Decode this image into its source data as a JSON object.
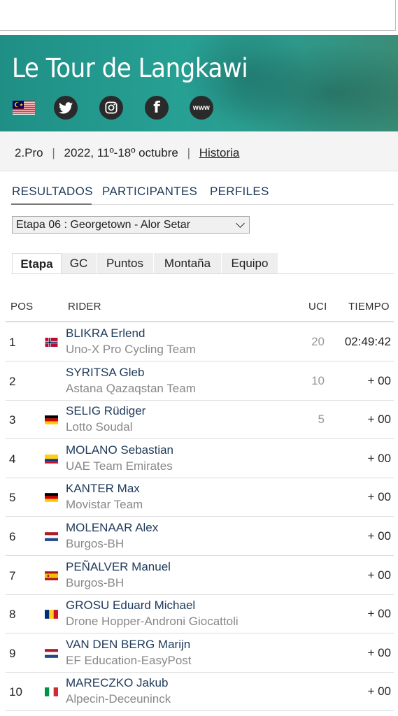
{
  "banner": {
    "title": "Le Tour de Langkawi",
    "social": {
      "twitter": "twitter-icon",
      "instagram": "instagram-icon",
      "facebook": "f",
      "web": "www"
    }
  },
  "meta": {
    "class": "2.Pro",
    "dates": "2022, 11º-18º octubre",
    "history_link": "Historia"
  },
  "tabs": [
    "RESULTADOS",
    "PARTICIPANTES",
    "PERFILES"
  ],
  "stage_select": {
    "value": "Etapa 06 : Georgetown - Alor Setar"
  },
  "subtabs": [
    "Etapa",
    "GC",
    "Puntos",
    "Montaña",
    "Equipo"
  ],
  "table": {
    "headers": {
      "pos": "POS",
      "rider": "RIDER",
      "uci": "UCI",
      "time": "TIEMPO"
    },
    "rows": [
      {
        "pos": "1",
        "flag": "NO",
        "name": "BLIKRA Erlend",
        "team": "Uno-X Pro Cycling Team",
        "uci": "20",
        "time": "02:49:42"
      },
      {
        "pos": "2",
        "flag": "",
        "name": "SYRITSA Gleb",
        "team": "Astana Qazaqstan Team",
        "uci": "10",
        "time": "+ 00"
      },
      {
        "pos": "3",
        "flag": "DE",
        "name": "SELIG Rüdiger",
        "team": "Lotto Soudal",
        "uci": "5",
        "time": "+ 00"
      },
      {
        "pos": "4",
        "flag": "CO",
        "name": "MOLANO Sebastian",
        "team": "UAE Team Emirates",
        "uci": "",
        "time": "+ 00"
      },
      {
        "pos": "5",
        "flag": "DE",
        "name": "KANTER Max",
        "team": "Movistar Team",
        "uci": "",
        "time": "+ 00"
      },
      {
        "pos": "6",
        "flag": "NL",
        "name": "MOLENAAR Alex",
        "team": "Burgos-BH",
        "uci": "",
        "time": "+ 00"
      },
      {
        "pos": "7",
        "flag": "ES",
        "name": "PEÑALVER Manuel",
        "team": "Burgos-BH",
        "uci": "",
        "time": "+ 00"
      },
      {
        "pos": "8",
        "flag": "RO",
        "name": "GROSU Eduard Michael",
        "team": "Drone Hopper-Androni Giocattoli",
        "uci": "",
        "time": "+ 00"
      },
      {
        "pos": "9",
        "flag": "NL",
        "name": "VAN DEN BERG Marijn",
        "team": "EF Education-EasyPost",
        "uci": "",
        "time": "+ 00"
      },
      {
        "pos": "10",
        "flag": "IT",
        "name": "MARECZKO Jakub",
        "team": "Alpecin-Deceuninck",
        "uci": "",
        "time": "+ 00"
      }
    ]
  }
}
